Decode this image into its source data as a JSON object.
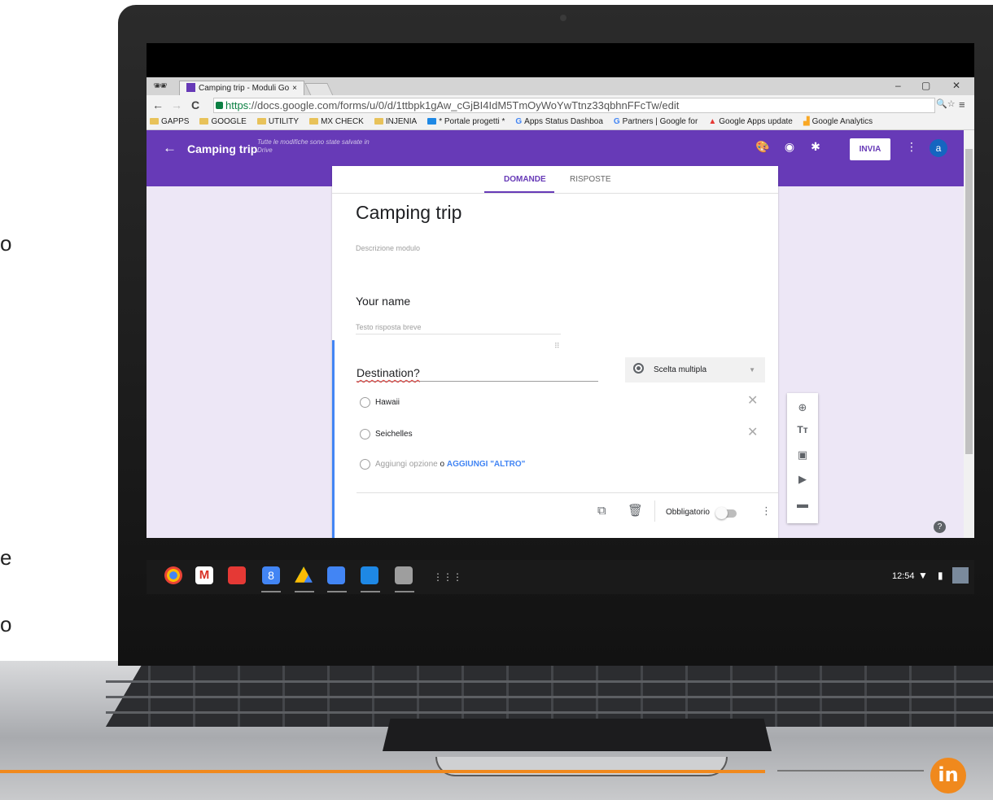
{
  "slide": {
    "left_fragments": [
      "o",
      "e",
      "o"
    ]
  },
  "browser": {
    "tab_title": "Camping trip - Moduli Go",
    "tab_close": "×",
    "window_controls": [
      "–",
      "▢",
      "✕"
    ],
    "url_https": "https:",
    "url_rest": "//docs.google.com/forms/u/0/d/1ttbpk1gAw_cGjBI4IdM5TmOyWoYwTtnz33qbhnFFcTw/edit",
    "bookmarks": [
      "GAPPS",
      "GOOGLE",
      "UTILITY",
      "MX CHECK",
      "INJENIA",
      "* Portale progetti *",
      "Apps Status Dashboa",
      "Partners | Google for",
      "Google Apps update",
      "Google Analytics"
    ]
  },
  "form": {
    "header_title": "Camping trip",
    "saved_status": "Tutte le modifiche sono state salvate in Drive",
    "send_button": "INVIA",
    "avatar_initial": "a",
    "tabs": [
      "DOMANDE",
      "RISPOSTE"
    ],
    "title": "Camping trip",
    "description_placeholder": "Descrizione modulo",
    "q1": {
      "label": "Your name",
      "hint": "Testo risposta breve"
    },
    "q2": {
      "title": "Destination?",
      "type": "Scelta multipla",
      "options": [
        "Hawaii",
        "Seichelles"
      ],
      "add_option": "Aggiungi opzione",
      "or": "o",
      "add_other": "AGGIUNGI \"ALTRO\"",
      "required_label": "Obbligatorio"
    }
  },
  "shelf": {
    "time": "12:54"
  },
  "colors": {
    "brand": "#673ab7",
    "accent": "#4285f4",
    "orange": "#f0891d"
  }
}
